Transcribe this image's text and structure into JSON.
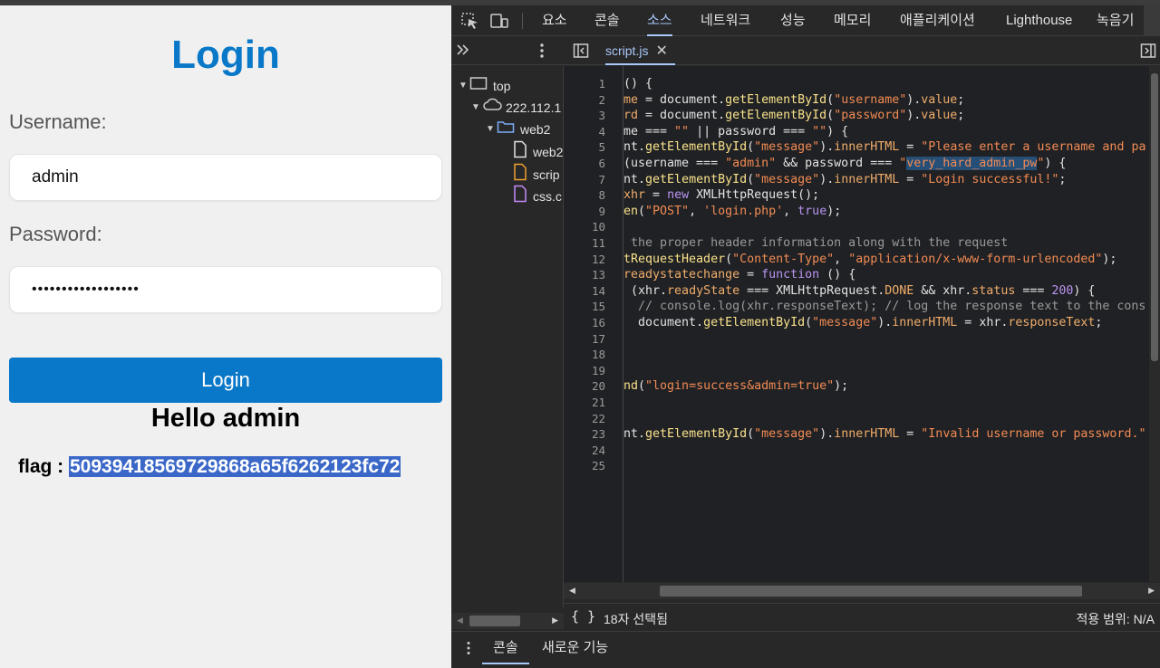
{
  "webpage": {
    "title": "Login",
    "username_label": "Username:",
    "username_value": "admin",
    "password_label": "Password:",
    "password_mask": "••••••••••••••••••",
    "login_button": "Login",
    "hello_message": "Hello admin",
    "flag_label": "flag : ",
    "flag_value": "50939418569729868a65f6262123fc72",
    "colors": {
      "accent": "#0a78c8",
      "background": "#f0f0f0"
    }
  },
  "devtools": {
    "tabs": [
      "요소",
      "콘솔",
      "소스",
      "네트워크",
      "성능",
      "메모리",
      "애플리케이션",
      "Lighthouse",
      "녹음기"
    ],
    "active_tab": "소스",
    "icons": [
      "inspect-element-icon",
      "device-toolbar-icon",
      "more-panels-icon",
      "kebab-menu-icon",
      "toggle-navigator-icon",
      "toggle-debugger-icon"
    ],
    "open_file": "script.js",
    "navigator": {
      "top": "top",
      "host": "222.112.1",
      "folder": "web2",
      "files": [
        "web2",
        "scrip",
        "css.c"
      ]
    },
    "line_numbers": [
      "1",
      "2",
      "3",
      "4",
      "5",
      "6",
      "7",
      "8",
      "9",
      "10",
      "11",
      "12",
      "13",
      "14",
      "15",
      "16",
      "17",
      "18",
      "19",
      "20",
      "21",
      "22",
      "23",
      "24",
      "25"
    ],
    "status": {
      "selection": "18자 선택됨",
      "scope": "적용 범위: N/A"
    },
    "drawer_tabs": [
      "콘솔",
      "새로운 기능"
    ]
  }
}
